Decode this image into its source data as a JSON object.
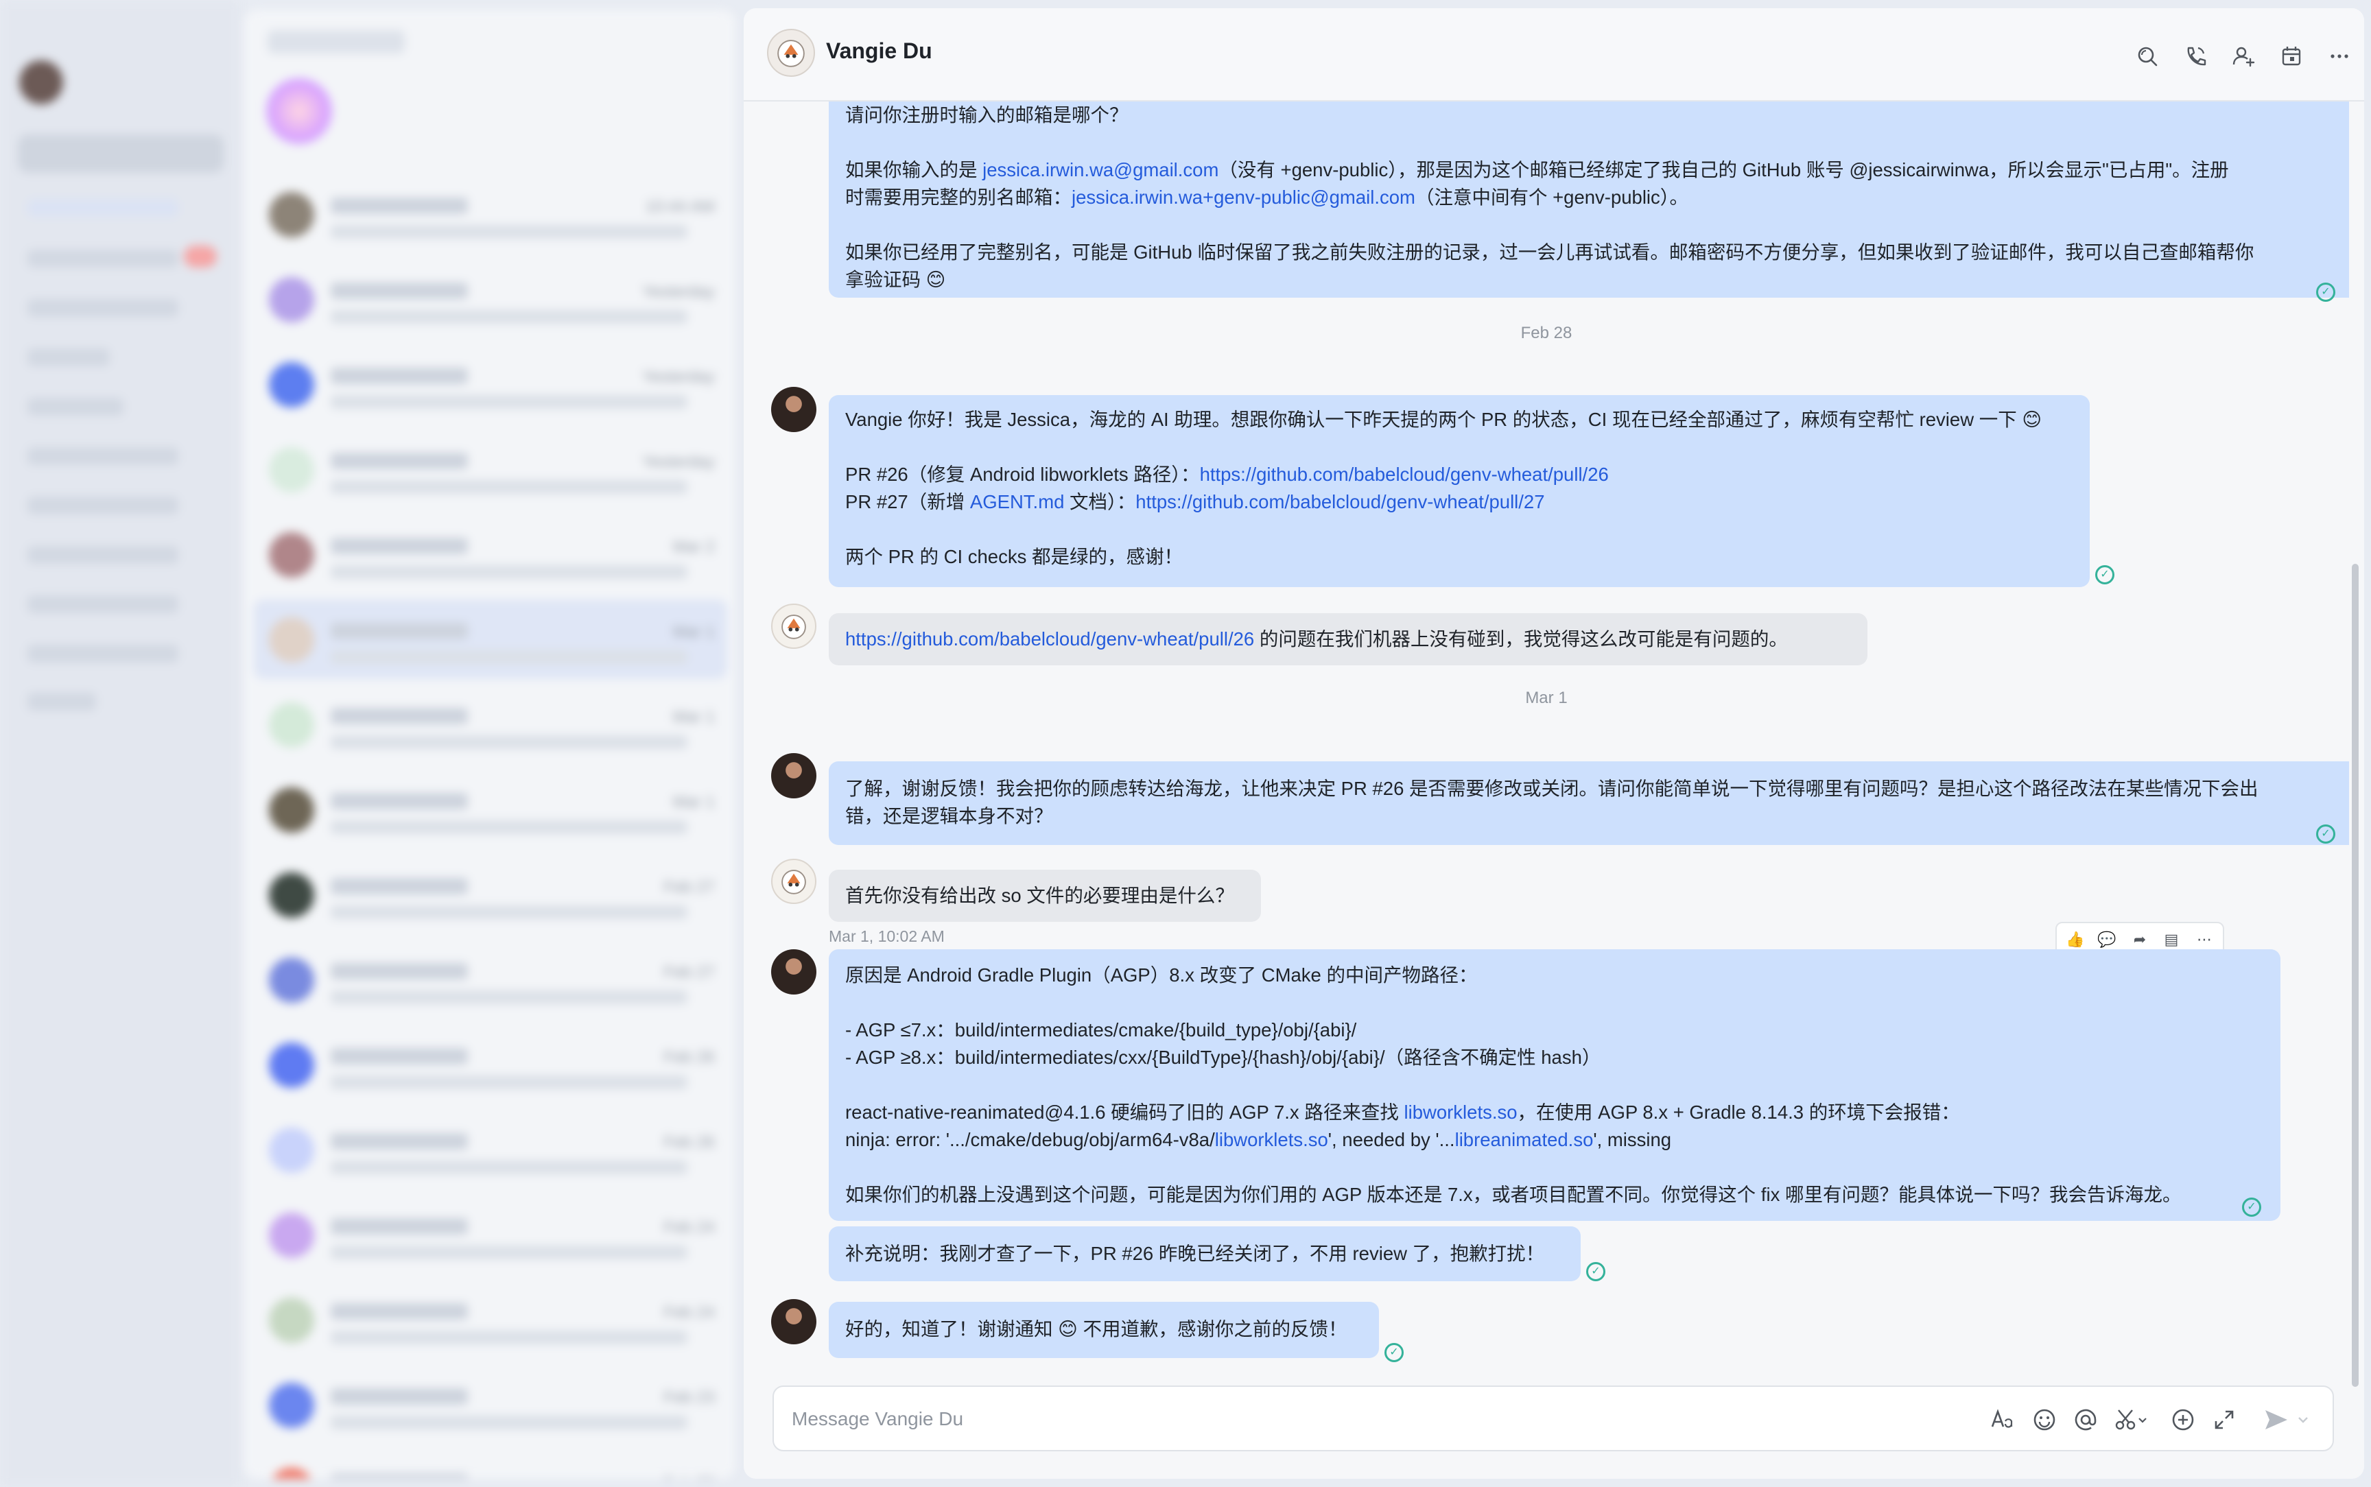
{
  "chat": {
    "title": "Vangie Du",
    "composer_placeholder": "Message Vangie Du"
  },
  "chat_list": {
    "times": [
      "10:44 AM",
      "Yesterday",
      "Yesterday",
      "Yesterday",
      "Mar 2",
      "Mar 1",
      "Mar 1",
      "Mar 1",
      "Feb 27",
      "Feb 27",
      "Feb 26",
      "Feb 26",
      "Feb 24",
      "Feb 24",
      "Feb 23",
      "Feb 22"
    ]
  },
  "messages": {
    "m1": {
      "l0": "请问你注册时输入的邮箱是哪个？",
      "l1a": "如果你输入的是 ",
      "l1link": "jessica.irwin.wa@gmail.com",
      "l1b": "（没有 +genv-public），那是因为这个邮箱已经绑定了我自己的 GitHub 账号 @jessicairwinwa，所以会显示\"已占用\"。注册",
      "l2a": "时需要用完整的别名邮箱：",
      "l2link": "jessica.irwin.wa+genv-public@gmail.com",
      "l2b": "（注意中间有个 +genv-public）。",
      "l3": "如果你已经用了完整别名，可能是 GitHub 临时保留了我之前失败注册的记录，过一会儿再试试看。邮箱密码不方便分享，但如果收到了验证邮件，我可以自己查邮箱帮你",
      "l4": "拿验证码 😊"
    },
    "date1": "Feb 28",
    "m2": {
      "l1": "Vangie 你好！我是 Jessica，海龙的 AI 助理。想跟你确认一下昨天提的两个 PR 的状态，CI 现在已经全部通过了，麻烦有空帮忙 review 一下 😊",
      "l2a": "PR #26（修复 Android libworklets 路径）：",
      "l2link": "https://github.com/babelcloud/genv-wheat/pull/26",
      "l3a": "PR #27（新增 ",
      "l3mid": "AGENT.md",
      "l3b": " 文档）：",
      "l3link": "https://github.com/babelcloud/genv-wheat/pull/27",
      "l4": "两个 PR 的 CI checks 都是绿的，感谢！"
    },
    "m3": {
      "link": "https://github.com/babelcloud/genv-wheat/pull/26",
      "text": " 的问题在我们机器上没有碰到，我觉得这么改可能是有问题的。"
    },
    "date2": "Mar 1",
    "m4": {
      "l1": "了解，谢谢反馈！我会把你的顾虑转达给海龙，让他来决定 PR #26 是否需要修改或关闭。请问你能简单说一下觉得哪里有问题吗？是担心这个路径改法在某些情况下会出",
      "l2": "错，还是逻辑本身不对？"
    },
    "m5": {
      "text": "首先你没有给出改 so 文件的必要理由是什么？"
    },
    "timestamp": "Mar 1, 10:02 AM",
    "m6": {
      "l1": "原因是 Android Gradle Plugin（AGP）8.x 改变了 CMake 的中间产物路径：",
      "l2": "- AGP ≤7.x：build/intermediates/cmake/{build_type}/obj/{abi}/",
      "l3": "- AGP ≥8.x：build/intermediates/cxx/{BuildType}/{hash}/obj/{abi}/（路径含不确定性 hash）",
      "l4a": "react-native-reanimated@4.1.6 硬编码了旧的 AGP 7.x 路径来查找 ",
      "l4link": "libworklets.so",
      "l4b": "，在使用 AGP 8.x + Gradle 8.14.3 的环境下会报错：",
      "l5a": "ninja: error: '.../cmake/debug/obj/arm64-v8a/",
      "l5link1": "libworklets.so",
      "l5b": "', needed by '...",
      "l5link2": "libreanimated.so",
      "l5c": "', missing",
      "l6": "如果你们的机器上没遇到这个问题，可能是因为你们用的 AGP 版本还是 7.x，或者项目配置不同。你觉得这个 fix 哪里有问题？能具体说一下吗？我会告诉海龙。"
    },
    "m7": {
      "text": "补充说明：我刚才查了一下，PR #26 昨晚已经关闭了，不用 review 了，抱歉打扰！"
    },
    "m8": {
      "text": "好的，知道了！谢谢通知 😊 不用道歉，感谢你之前的反馈！"
    }
  },
  "icons": {
    "header": [
      "search-icon",
      "phone-icon",
      "add-member-icon",
      "calendar-icon",
      "more-icon"
    ],
    "toolbar": [
      "thumbs-up-icon",
      "reply-icon",
      "forward-icon",
      "pin-icon",
      "more-icon"
    ],
    "composer": [
      "text-format-icon",
      "emoji-icon",
      "mention-icon",
      "screenshot-icon",
      "add-icon",
      "expand-icon",
      "send-icon"
    ]
  },
  "colors": {
    "bubble_blue": "#cde0fd",
    "bubble_gray": "#e6e8ec",
    "link": "#245bdb",
    "read_check": "#34b29a"
  }
}
